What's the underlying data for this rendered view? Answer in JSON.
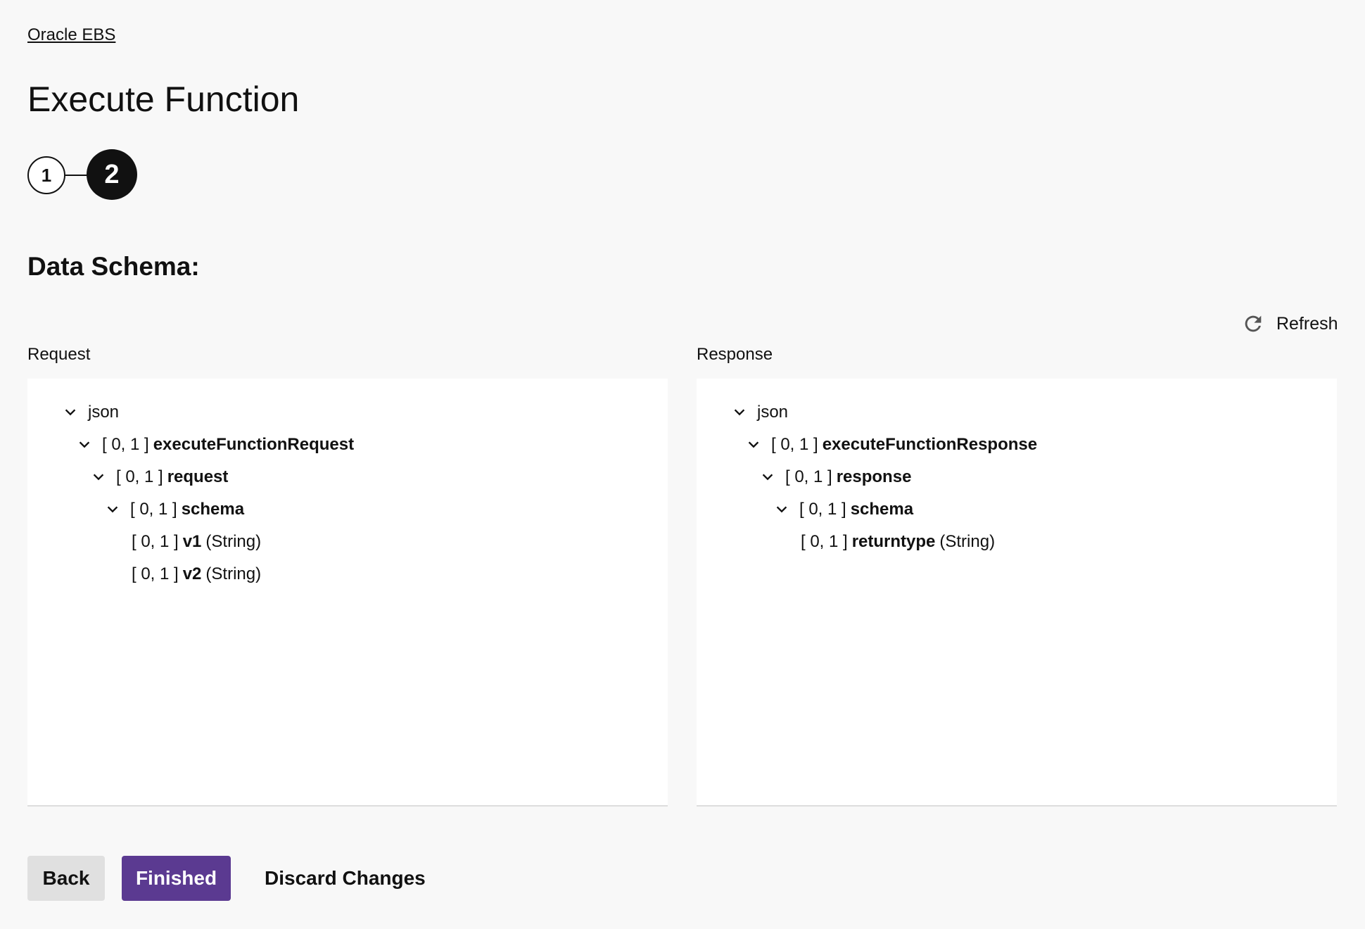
{
  "breadcrumb": "Oracle EBS",
  "page_title": "Execute Function",
  "stepper": {
    "step1": "1",
    "step2": "2",
    "current_step": 2
  },
  "section_title": "Data Schema:",
  "refresh_label": "Refresh",
  "request": {
    "label": "Request",
    "rows": [
      {
        "root": "json"
      },
      {
        "card": "[ 0, 1 ]",
        "name": "executeFunctionRequest"
      },
      {
        "card": "[ 0, 1 ]",
        "name": "request"
      },
      {
        "card": "[ 0, 1 ]",
        "name": "schema"
      },
      {
        "card": "[ 0, 1 ]",
        "name": "v1",
        "type": "(String)"
      },
      {
        "card": "[ 0, 1 ]",
        "name": "v2",
        "type": "(String)"
      }
    ]
  },
  "response": {
    "label": "Response",
    "rows": [
      {
        "root": "json"
      },
      {
        "card": "[ 0, 1 ]",
        "name": "executeFunctionResponse"
      },
      {
        "card": "[ 0, 1 ]",
        "name": "response"
      },
      {
        "card": "[ 0, 1 ]",
        "name": "schema"
      },
      {
        "card": "[ 0, 1 ]",
        "name": "returntype",
        "type": "(String)"
      }
    ]
  },
  "buttons": {
    "back": "Back",
    "finished": "Finished",
    "discard": "Discard Changes"
  },
  "colors": {
    "primary": "#5b3a91",
    "secondary_button": "#e0e0e0",
    "background": "#f8f8f8"
  }
}
